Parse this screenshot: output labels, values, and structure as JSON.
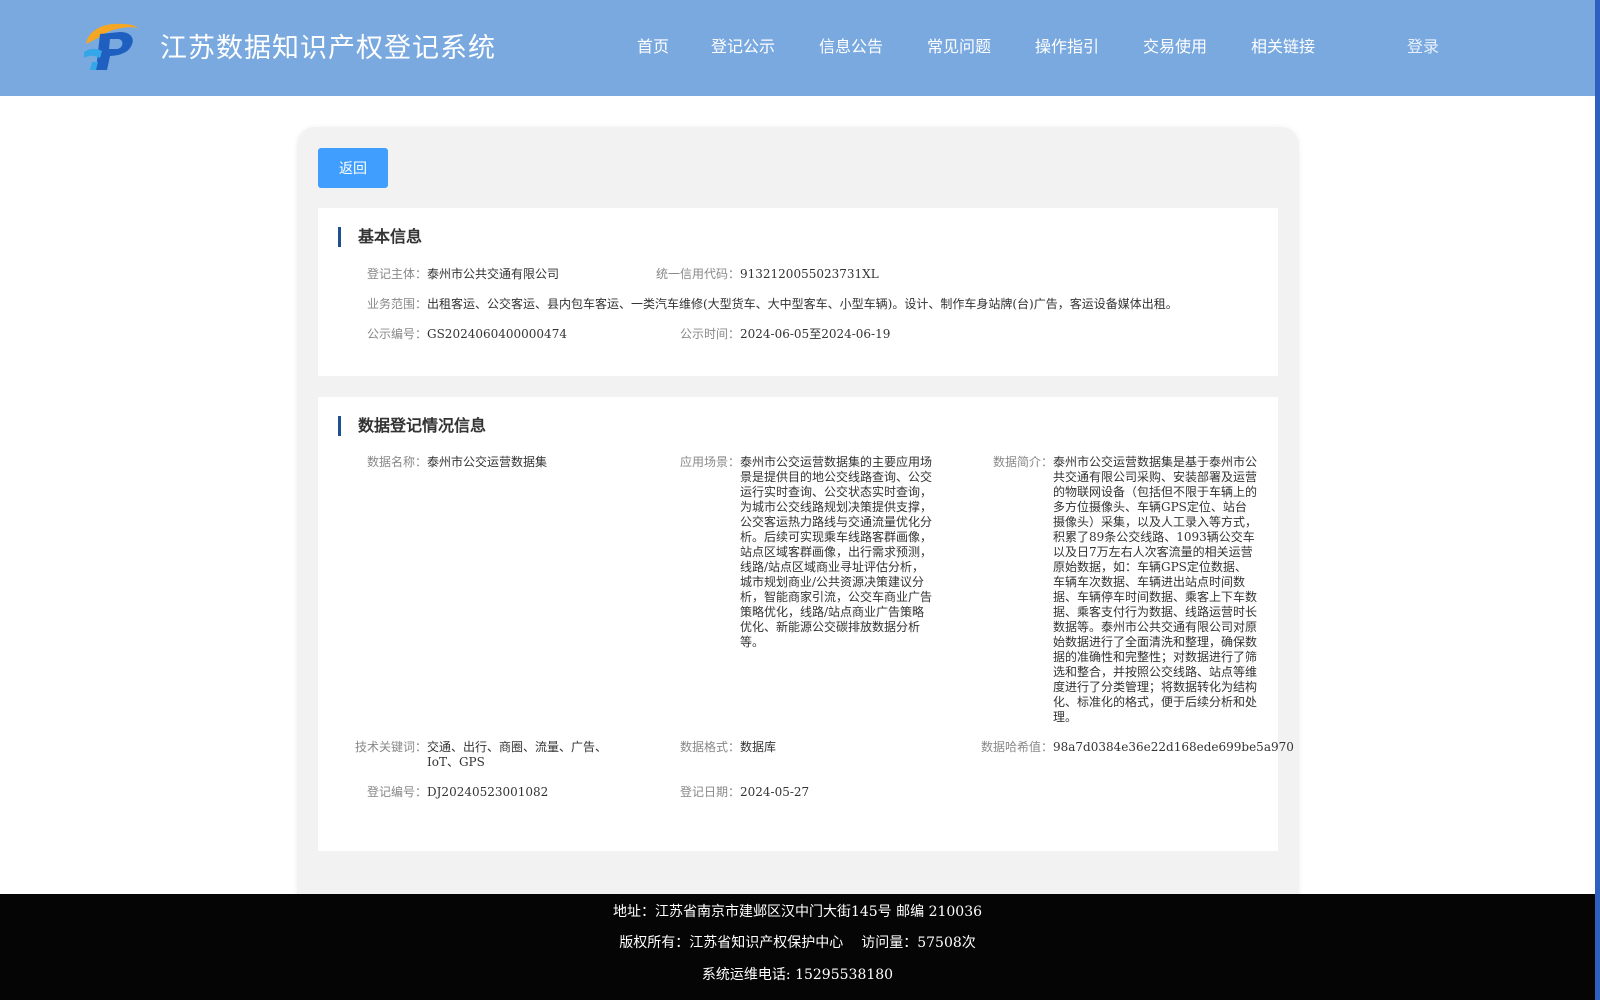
{
  "header": {
    "title": "江苏数据知识产权登记系统",
    "nav": [
      "首页",
      "登记公示",
      "信息公告",
      "常见问题",
      "操作指引",
      "交易使用",
      "相关链接"
    ],
    "login": "登录"
  },
  "actions": {
    "back": "返回"
  },
  "basic": {
    "title": "基本信息",
    "subject_label": "登记主体：",
    "subject": "泰州市公共交通有限公司",
    "credit_label": "统一信用代码：",
    "credit": "913212005502373 1XL",
    "scope_label": "业务范围：",
    "scope": "出租客运、公交客运、县内包车客运、一类汽车维修(大型货车、大中型客车、小型车辆)。设计、制作车身站牌(台)广告，客运设备媒体出租。",
    "notice_no_label": "公示编号：",
    "notice_no": "GS2024060400000474",
    "notice_time_label": "公示时间：",
    "notice_time": "2024-06-05至2024-06-19"
  },
  "registration": {
    "title": "数据登记情况信息",
    "name_label": "数据名称：",
    "name": "泰州市公交运营数据集",
    "scene_label": "应用场景：",
    "scene": "泰州市公交运营数据集的主要应用场景是提供目的地公交线路查询、公交运行实时查询、公交状态实时查询，为城市公交线路规划决策提供支撑，公交客运热力路线与交通流量优化分析。后续可实现乘车线路客群画像，站点区域客群画像，出行需求预测，线路/站点区域商业寻址评估分析，城市规划商业/公共资源决策建议分析，智能商家引流，公交车商业广告策略优化，线路/站点商业广告策略优化、新能源公交碳排放数据分析等。",
    "intro_label": "数据简介：",
    "intro": "泰州市公交运营数据集是基于泰州市公共交通有限公司采购、安装部署及运营的物联网设备（包括但不限于车辆上的多方位摄像头、车辆GPS定位、站台摄像头）采集，以及人工录入等方式，积累了89条公交线路、1093辆公交车以及日7万左右人次客流量的相关运营原始数据，如：车辆GPS定位数据、车辆车次数据、车辆进出站点时间数据、车辆停车时间数据、乘客上下车数据、乘客支付行为数据、线路运营时长数据等。泰州市公共交通有限公司对原始数据进行了全面清洗和整理，确保数据的准确性和完整性；对数据进行了筛选和整合，并按照公交线路、站点等维度进行了分类管理；将数据转化为结构化、标准化的格式，便于后续分析和处理。",
    "keywords_label": "技术关键词：",
    "keywords": "交通、出行、商圈、流量、广告、IoT、GPS",
    "format_label": "数据格式：",
    "format": "数据库",
    "hash_label": "数据哈希值：",
    "hash": "98a7d0384e36e22d168ede699be5a970",
    "reg_no_label": "登记编号：",
    "reg_no": "DJ20240523001082",
    "reg_date_label": "登记日期：",
    "reg_date": "2024-05-27"
  },
  "footer": {
    "address": "地址：江苏省南京市建邺区汉中门大街145号 邮编 210036",
    "copyright": "版权所有：江苏省知识产权保护中心",
    "visits": "访问量：57508次",
    "phone": "系统运维电话: 15295538180"
  },
  "colors": {
    "header": "#79a9df",
    "button": "#409eff",
    "footer": "#050505",
    "section_bar": "#1f4f8f"
  },
  "icons": {
    "logo": "jiangsu-ip-logo-icon"
  }
}
